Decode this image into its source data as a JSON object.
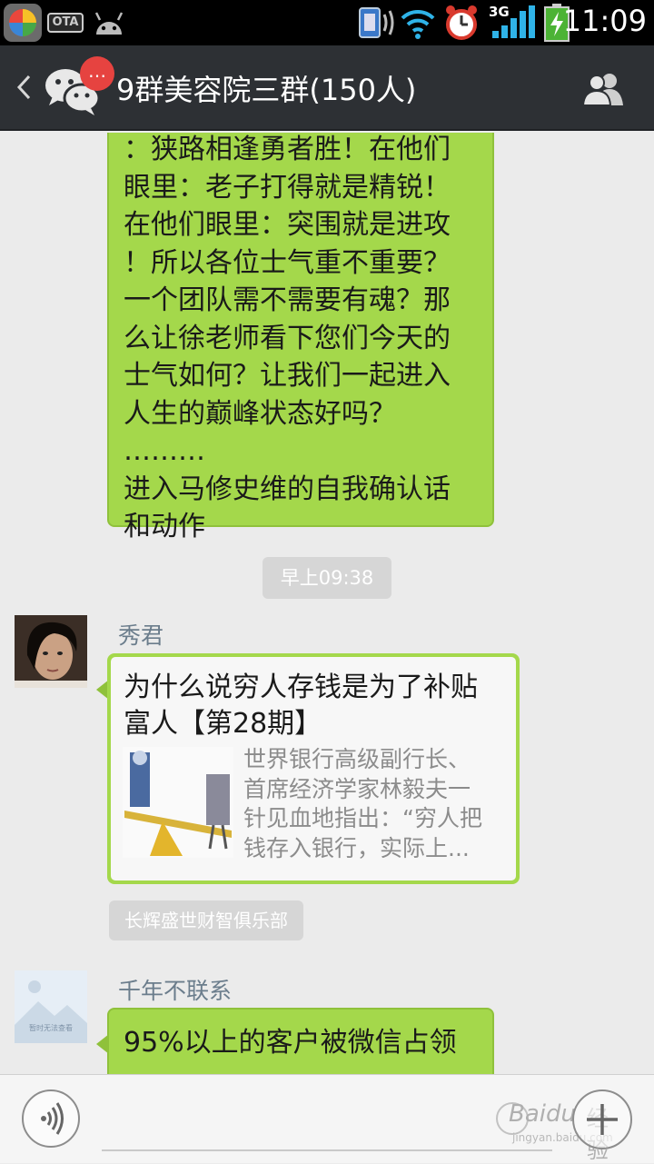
{
  "status_bar": {
    "time": "11:09",
    "network": "3G",
    "ota_label": "OTA"
  },
  "header": {
    "title": "9群美容院三群(150人)",
    "badge": "…"
  },
  "messages": [
    {
      "type": "text",
      "side": "right",
      "lines": [
        "：狭路相逢勇者胜！在他们",
        "眼里：老子打得就是精锐！",
        "在他们眼里：突围就是进攻",
        "！所以各位士气重不重要？",
        "一个团队需不需要有魂？那",
        "么让徐老师看下您们今天的",
        "士气如何？让我们一起进入",
        "人生的巅峰状态好吗？ ………",
        "进入马修史维的自我确认话",
        "和动作"
      ]
    },
    {
      "type": "time",
      "text": "早上09:38"
    },
    {
      "type": "article",
      "sender": "秀君",
      "title_lines": [
        "为什么说穷人存钱是为了补贴",
        "富人【第28期】"
      ],
      "desc_lines": [
        "世界银行高级副行长、",
        "首席经济学家林毅夫一",
        "针见血地指出：“穷人把",
        "钱存入银行，实际上..."
      ],
      "source": "长辉盛世财智俱乐部"
    },
    {
      "type": "text",
      "sender": "千年不联系",
      "avatar_placeholder": "暂时无法查看",
      "lines": [
        "95%以上的客户被微信占领"
      ]
    }
  ],
  "watermark": {
    "brand": "Baidu",
    "suffix": "经验",
    "url": "jingyan.baidu.com"
  },
  "colors": {
    "header_bg": "#2d3034",
    "bubble_green": "#a4d84b",
    "chat_bg": "#ebebeb",
    "badge_red": "#e64340"
  }
}
